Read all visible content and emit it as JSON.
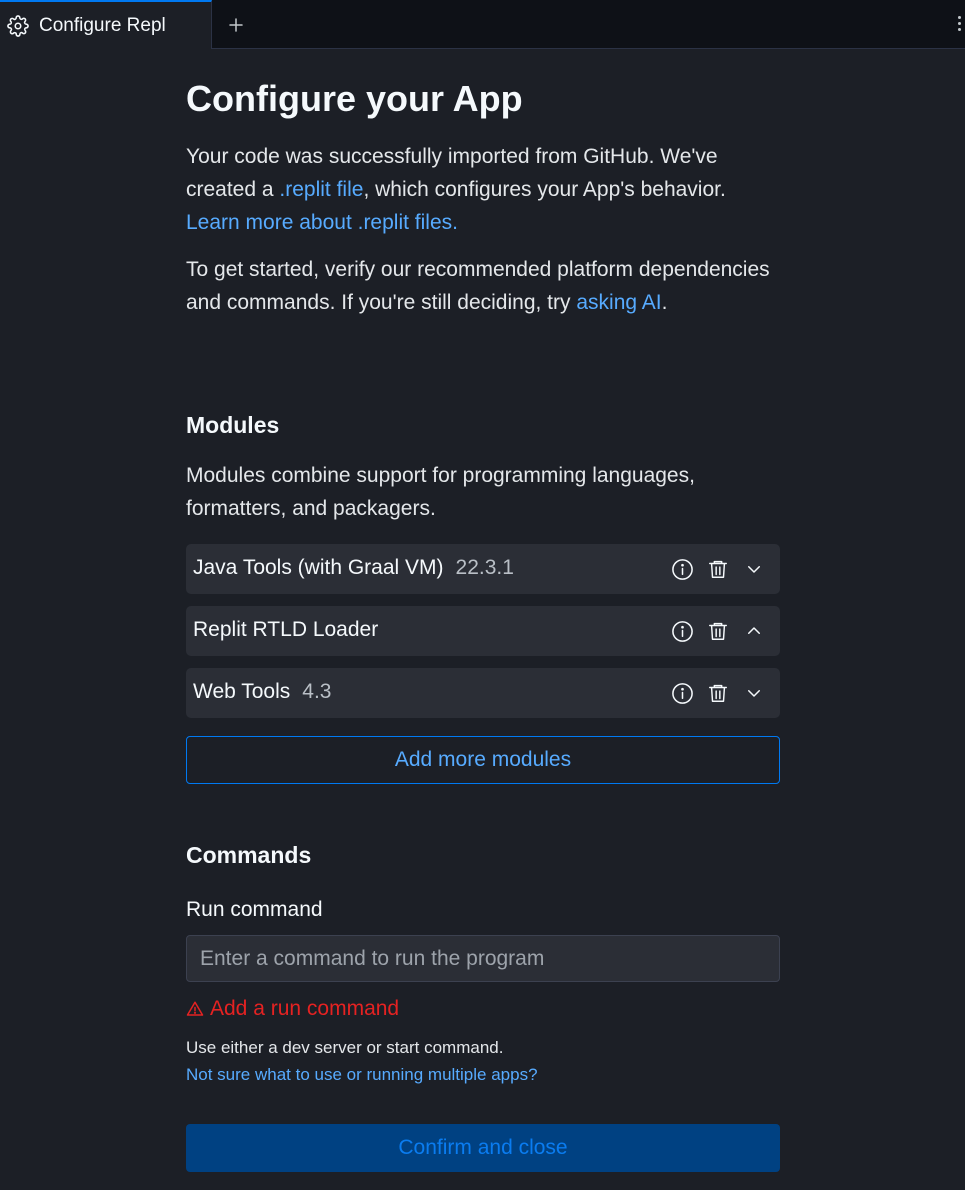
{
  "tabs": {
    "active_label": "Configure Repl",
    "icon": "gear-icon",
    "new_tab_icon": "plus-icon",
    "menu_icon": "kebab-menu-icon"
  },
  "page": {
    "title": "Configure your App",
    "intro": {
      "part1": "Your code was successfully imported from GitHub. We've created a ",
      "link1": ".replit file",
      "part2": ", which configures your App's behavior. ",
      "link2": "Learn more about .replit files."
    },
    "getting_started": {
      "part1": "To get started, verify our recommended platform dependencies and commands. If you're still deciding, try ",
      "link": "asking AI",
      "part2": "."
    }
  },
  "modules": {
    "heading": "Modules",
    "description": "Modules combine support for programming languages, formatters, and packagers.",
    "items": [
      {
        "name": "Java Tools (with Graal VM)",
        "version": "22.3.1",
        "expanded": false
      },
      {
        "name": "Replit RTLD Loader",
        "version": "",
        "expanded": true
      },
      {
        "name": "Web Tools",
        "version": "4.3",
        "expanded": false
      }
    ],
    "add_button": "Add more modules"
  },
  "commands": {
    "heading": "Commands",
    "run_label": "Run command",
    "run_value": "",
    "run_placeholder": "Enter a command to run the program",
    "error": "Add a run command",
    "hint": "Use either a dev server or start command.",
    "hint_link": "Not sure what to use or running multiple apps?"
  },
  "footer": {
    "confirm_label": "Confirm and close"
  },
  "colors": {
    "accent": "#0079f2",
    "link": "#57abff",
    "error": "#e52222",
    "background": "#1c1f26",
    "surface": "#2b2e36"
  }
}
